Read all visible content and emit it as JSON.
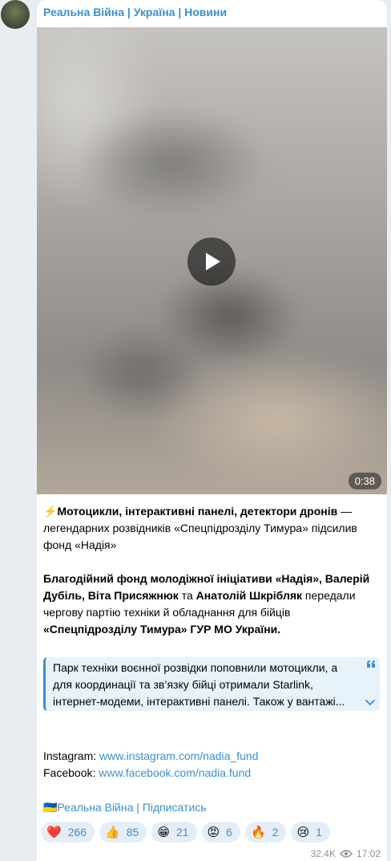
{
  "channel": {
    "name": "Реальна Війна | Україна | Новини"
  },
  "video": {
    "duration": "0:38"
  },
  "post": {
    "p1_emoji": "⚡",
    "p1_bold": "Мотоцикли, інтерактивні панелі, детектори дронів",
    "p1_rest": " — легендарних розвідників «Спецпідрозділу Тимура» підсилив фонд «Надія»",
    "p2_bold1": "Благодійний фонд молодіжної ініціативи «Надія», Валерій Дубіль, Віта Присяжнюк",
    "p2_t1": " та ",
    "p2_bold2": "Анатолій Шкрібляк",
    "p2_t2": " передали чергову партію техніки й обладнання для бійців ",
    "p2_bold3": "«Спецпідрозділу Тимура» ГУР МО України."
  },
  "quote": {
    "line1": "Парк техніки воєнної розвідки поповнили мотоцикли, а",
    "line2": "для координації та зв’язку бійці отримали Starlink,",
    "line3": "інтернет-модеми, інтерактивні панелі. Також у вантажі..."
  },
  "links": {
    "instagram_label": "Instagram: ",
    "instagram_url": "www.instagram.com/nadia_fund",
    "facebook_label": "Facebook: ",
    "facebook_url": "www.facebook.com/nadia.fund"
  },
  "subscribe": {
    "flag": "🇺🇦",
    "channel": "Реальна Війна",
    "sep": " | ",
    "action": "Підписатись"
  },
  "reactions": [
    {
      "emoji": "❤️",
      "count": "266"
    },
    {
      "emoji": "👍",
      "count": "85"
    },
    {
      "emoji": "😁",
      "count": "21"
    },
    {
      "emoji": "😡",
      "count": "6"
    },
    {
      "emoji": "🔥",
      "count": "2"
    },
    {
      "emoji": "😢",
      "count": "1"
    }
  ],
  "meta": {
    "views": "32.4K",
    "time": "17:02"
  },
  "icons": {
    "play": "play-icon",
    "quote": "quote-icon",
    "expand": "chevron-down-icon",
    "views": "eye-icon"
  },
  "colors": {
    "accent": "#3a8fd0",
    "background": "#e8edf1",
    "quote_bg": "#e7f2fb"
  }
}
